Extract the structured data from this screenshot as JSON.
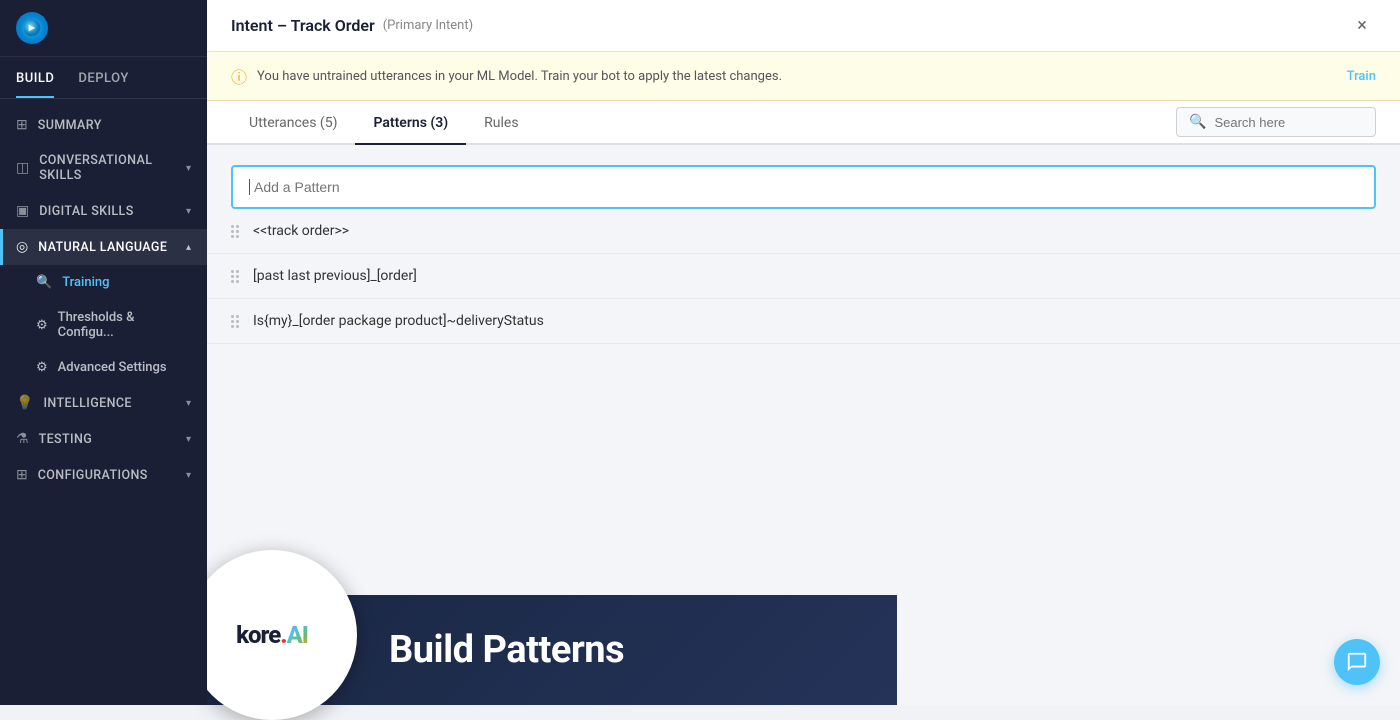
{
  "sidebar": {
    "logo_alt": "kore logo",
    "nav_tabs": [
      {
        "label": "BUILD",
        "active": true
      },
      {
        "label": "DEPLOY",
        "active": false
      }
    ],
    "items": [
      {
        "id": "summary",
        "label": "SUMMARY",
        "icon": "grid-icon",
        "has_chevron": false,
        "active": false,
        "type": "top"
      },
      {
        "id": "conversational-skills",
        "label": "CONVERSATIONAL SKILLS",
        "icon": "layers-icon",
        "has_chevron": true,
        "active": false,
        "type": "top"
      },
      {
        "id": "digital-skills",
        "label": "DIGITAL SKILLS",
        "icon": "monitor-icon",
        "has_chevron": true,
        "active": false,
        "type": "top"
      },
      {
        "id": "natural-language",
        "label": "NATURAL LANGUAGE",
        "icon": "globe-icon",
        "has_chevron": true,
        "active": true,
        "type": "top"
      },
      {
        "id": "training",
        "label": "Training",
        "active": true,
        "type": "sub"
      },
      {
        "id": "thresholds",
        "label": "Thresholds & Configu...",
        "active": false,
        "type": "sub"
      },
      {
        "id": "advanced-settings",
        "label": "Advanced Settings",
        "active": false,
        "type": "sub"
      },
      {
        "id": "intelligence",
        "label": "INTELLIGENCE",
        "icon": "bulb-icon",
        "has_chevron": true,
        "active": false,
        "type": "top"
      },
      {
        "id": "testing",
        "label": "TESTING",
        "icon": "flask-icon",
        "has_chevron": true,
        "active": false,
        "type": "top"
      },
      {
        "id": "configurations",
        "label": "CONFIGURATIONS",
        "icon": "settings-icon",
        "has_chevron": true,
        "active": false,
        "type": "top"
      }
    ]
  },
  "header": {
    "title": "Intent – Track Order",
    "subtitle": "(Primary Intent)",
    "close_label": "×"
  },
  "alert": {
    "message": "You have untrained utterances in your ML Model. Train your bot to apply the latest changes.",
    "link_label": "Train"
  },
  "tabs": {
    "items": [
      {
        "label": "Utterances (5)",
        "active": false
      },
      {
        "label": "Patterns (3)",
        "active": true
      },
      {
        "label": "Rules",
        "active": false
      }
    ],
    "search_placeholder": "Search here"
  },
  "patterns": {
    "add_placeholder": "Add a Pattern",
    "items": [
      {
        "text": "<<track order>>"
      },
      {
        "text": "[past last previous]_[order]"
      },
      {
        "text": "Is{my}_[order package product]~deliveryStatus"
      }
    ]
  },
  "bottom_banner": {
    "label": "Build Patterns"
  },
  "brand": {
    "name": "kore.",
    "suffix": "AI"
  }
}
